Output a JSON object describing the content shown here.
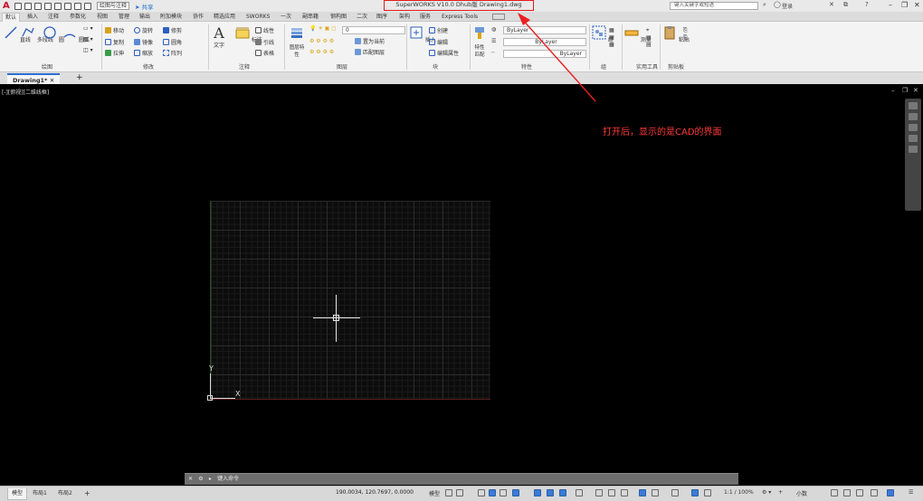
{
  "app": {
    "logo": "A",
    "workspace": "绘图与注释",
    "share": "共享",
    "doc_title": "SuperWORKS V10.0 Dhub版     Drawing1.dwg",
    "search_placeholder": "键入关键字或短语",
    "user": "登录"
  },
  "ribbon_tabs": [
    "默认",
    "插入",
    "注释",
    "参数化",
    "视图",
    "管理",
    "输出",
    "附加模块",
    "协作",
    "精选应用",
    "SWORKS",
    "一次",
    "副串籍",
    "钢构图",
    "二次",
    "图序",
    "架构",
    "服务",
    "Express Tools"
  ],
  "ribbon": {
    "draw_panel": {
      "title": "绘图",
      "line": "直线",
      "polyline": "多段线",
      "circle": "圆",
      "arc": "圆弧"
    },
    "modify_panel": {
      "title": "修改",
      "move": "移动",
      "rotate": "旋转",
      "trim": "修剪",
      "copy": "复制",
      "mirror": "镜像",
      "fillet": "圆角",
      "stretch": "拉伸",
      "scale": "缩放",
      "array": "阵列"
    },
    "annotation_panel": {
      "title": "注释",
      "text": "文字",
      "dimension": "标注",
      "linear": "线性",
      "leader": "引线",
      "table": "表格"
    },
    "layers_panel": {
      "title": "图层",
      "layer_props": "图层特性",
      "layer_value": "0",
      "make_current": "置为当前",
      "match_layer": "匹配图层"
    },
    "block_panel": {
      "title": "块",
      "insert": "插入",
      "create": "创建",
      "edit": "编辑",
      "edit_attributes": "编辑属性"
    },
    "properties_panel": {
      "title": "特性",
      "match": "特性匹配",
      "color": "ByLayer",
      "linetype": "ByLayer",
      "lineweight": "ByLayer"
    },
    "groups_panel": {
      "title": "组",
      "group": "组"
    },
    "utilities_panel": {
      "title": "实用工具",
      "measure": "测量"
    },
    "clipboard_panel": {
      "title": "剪贴板",
      "paste": "粘贴"
    }
  },
  "file_tabs": [
    "Drawing1*"
  ],
  "viewport": {
    "label": "[-][俯视][二维线框]",
    "annotation": "打开后，显示的是CAD的界面",
    "ucs_y": "Y",
    "ucs_x": "X",
    "command_placeholder": "键入命令"
  },
  "layout_tabs": [
    "模型",
    "布局1",
    "布局2"
  ],
  "status": {
    "coordinates": "190.0034, 120.7697, 0.0000",
    "model": "模型",
    "scale": "1:1 / 100%",
    "units": "小数"
  }
}
